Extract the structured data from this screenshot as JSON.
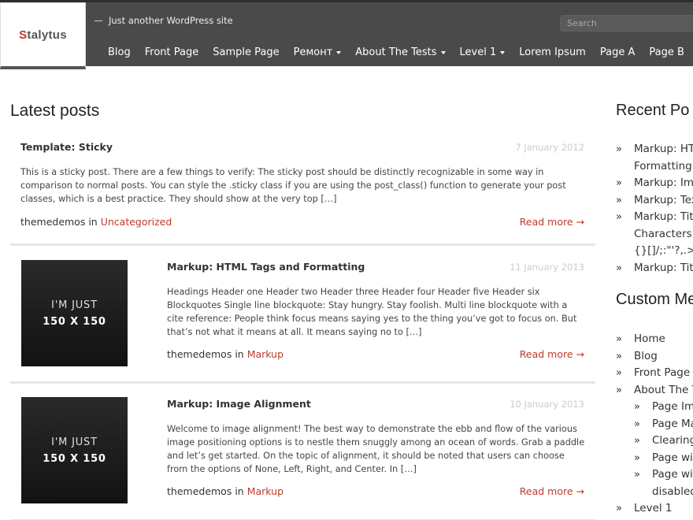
{
  "site": {
    "logo_first": "S",
    "logo_rest": "talytus",
    "tagline": "Just another WordPress site",
    "search_placeholder": "Search"
  },
  "nav": {
    "items": [
      {
        "label": "Blog",
        "dropdown": false
      },
      {
        "label": "Front Page",
        "dropdown": false
      },
      {
        "label": "Sample Page",
        "dropdown": false
      },
      {
        "label": "Ремонт",
        "dropdown": true
      },
      {
        "label": "About The Tests",
        "dropdown": true
      },
      {
        "label": "Level 1",
        "dropdown": true
      },
      {
        "label": "Lorem Ipsum",
        "dropdown": false
      },
      {
        "label": "Page A",
        "dropdown": false
      },
      {
        "label": "Page B",
        "dropdown": false
      }
    ]
  },
  "main": {
    "title": "Latest posts",
    "posts": [
      {
        "title": "Template: Sticky",
        "date": "7 January 2012",
        "excerpt": "This is a sticky post. There are a few things to verify: The sticky post should be distinctly recognizable in some way in comparison to normal posts. You can style the .sticky class if you are using the post_class() function to generate your post classes, which is a best practice. They should show at the very top […]",
        "author": "themedemos",
        "in_label": "in",
        "category": "Uncategorized",
        "read_more": "Read more →"
      },
      {
        "title": "Markup: HTML Tags and Formatting",
        "date": "11 January 2013",
        "excerpt": "Headings Header one Header two Header three Header four Header five Header six Blockquotes Single line blockquote: Stay hungry. Stay foolish. Multi line blockquote with a cite reference: People think focus means saying yes to the thing you’ve got to focus on. But that’s not what it means at all. It means saying no to […]",
        "author": "themedemos",
        "in_label": "in",
        "category": "Markup",
        "read_more": "Read more →",
        "thumb_line1": "I'M JUST",
        "thumb_line2": "150 X 150"
      },
      {
        "title": "Markup: Image Alignment",
        "date": "10 January 2013",
        "excerpt": "Welcome to image alignment! The best way to demonstrate the ebb and flow of the various image positioning options is to nestle them snuggly among an ocean of words. Grab a paddle and let’s get started. On the topic of alignment, it should be noted that users can choose from the options of None, Left, Right, and Center. In […]",
        "author": "themedemos",
        "in_label": "in",
        "category": "Markup",
        "read_more": "Read more →",
        "thumb_line1": "I'M JUST",
        "thumb_line2": "150 X 150"
      }
    ]
  },
  "sidebar": {
    "recent_title": "Recent Po",
    "recent_items": [
      {
        "lines": [
          "Markup: HT",
          "Formatting"
        ]
      },
      {
        "lines": [
          "Markup: Ima"
        ]
      },
      {
        "lines": [
          "Markup: Tex"
        ]
      },
      {
        "lines": [
          "Markup: Titl",
          "Characters ~",
          "{}[]/;:\"'?,.>"
        ]
      },
      {
        "lines": [
          "Markup: Titl"
        ]
      }
    ],
    "custom_title": "Custom Me",
    "menu_items": [
      {
        "label": "Home",
        "level": 1
      },
      {
        "label": "Blog",
        "level": 1
      },
      {
        "label": "Front Page",
        "level": 1
      },
      {
        "label": "About The T",
        "level": 1
      },
      {
        "label": "Page Ima",
        "level": 2
      },
      {
        "label": "Page Ma",
        "level": 2
      },
      {
        "label": "Clearing",
        "level": 2
      },
      {
        "label": "Page wit",
        "level": 2
      },
      {
        "label": "Page wit",
        "level": 2,
        "cont": "disabled"
      },
      {
        "label": "Level 1",
        "level": 1
      }
    ]
  },
  "colors": {
    "accent": "#c0392b",
    "header_bg": "#4a4a4a"
  }
}
